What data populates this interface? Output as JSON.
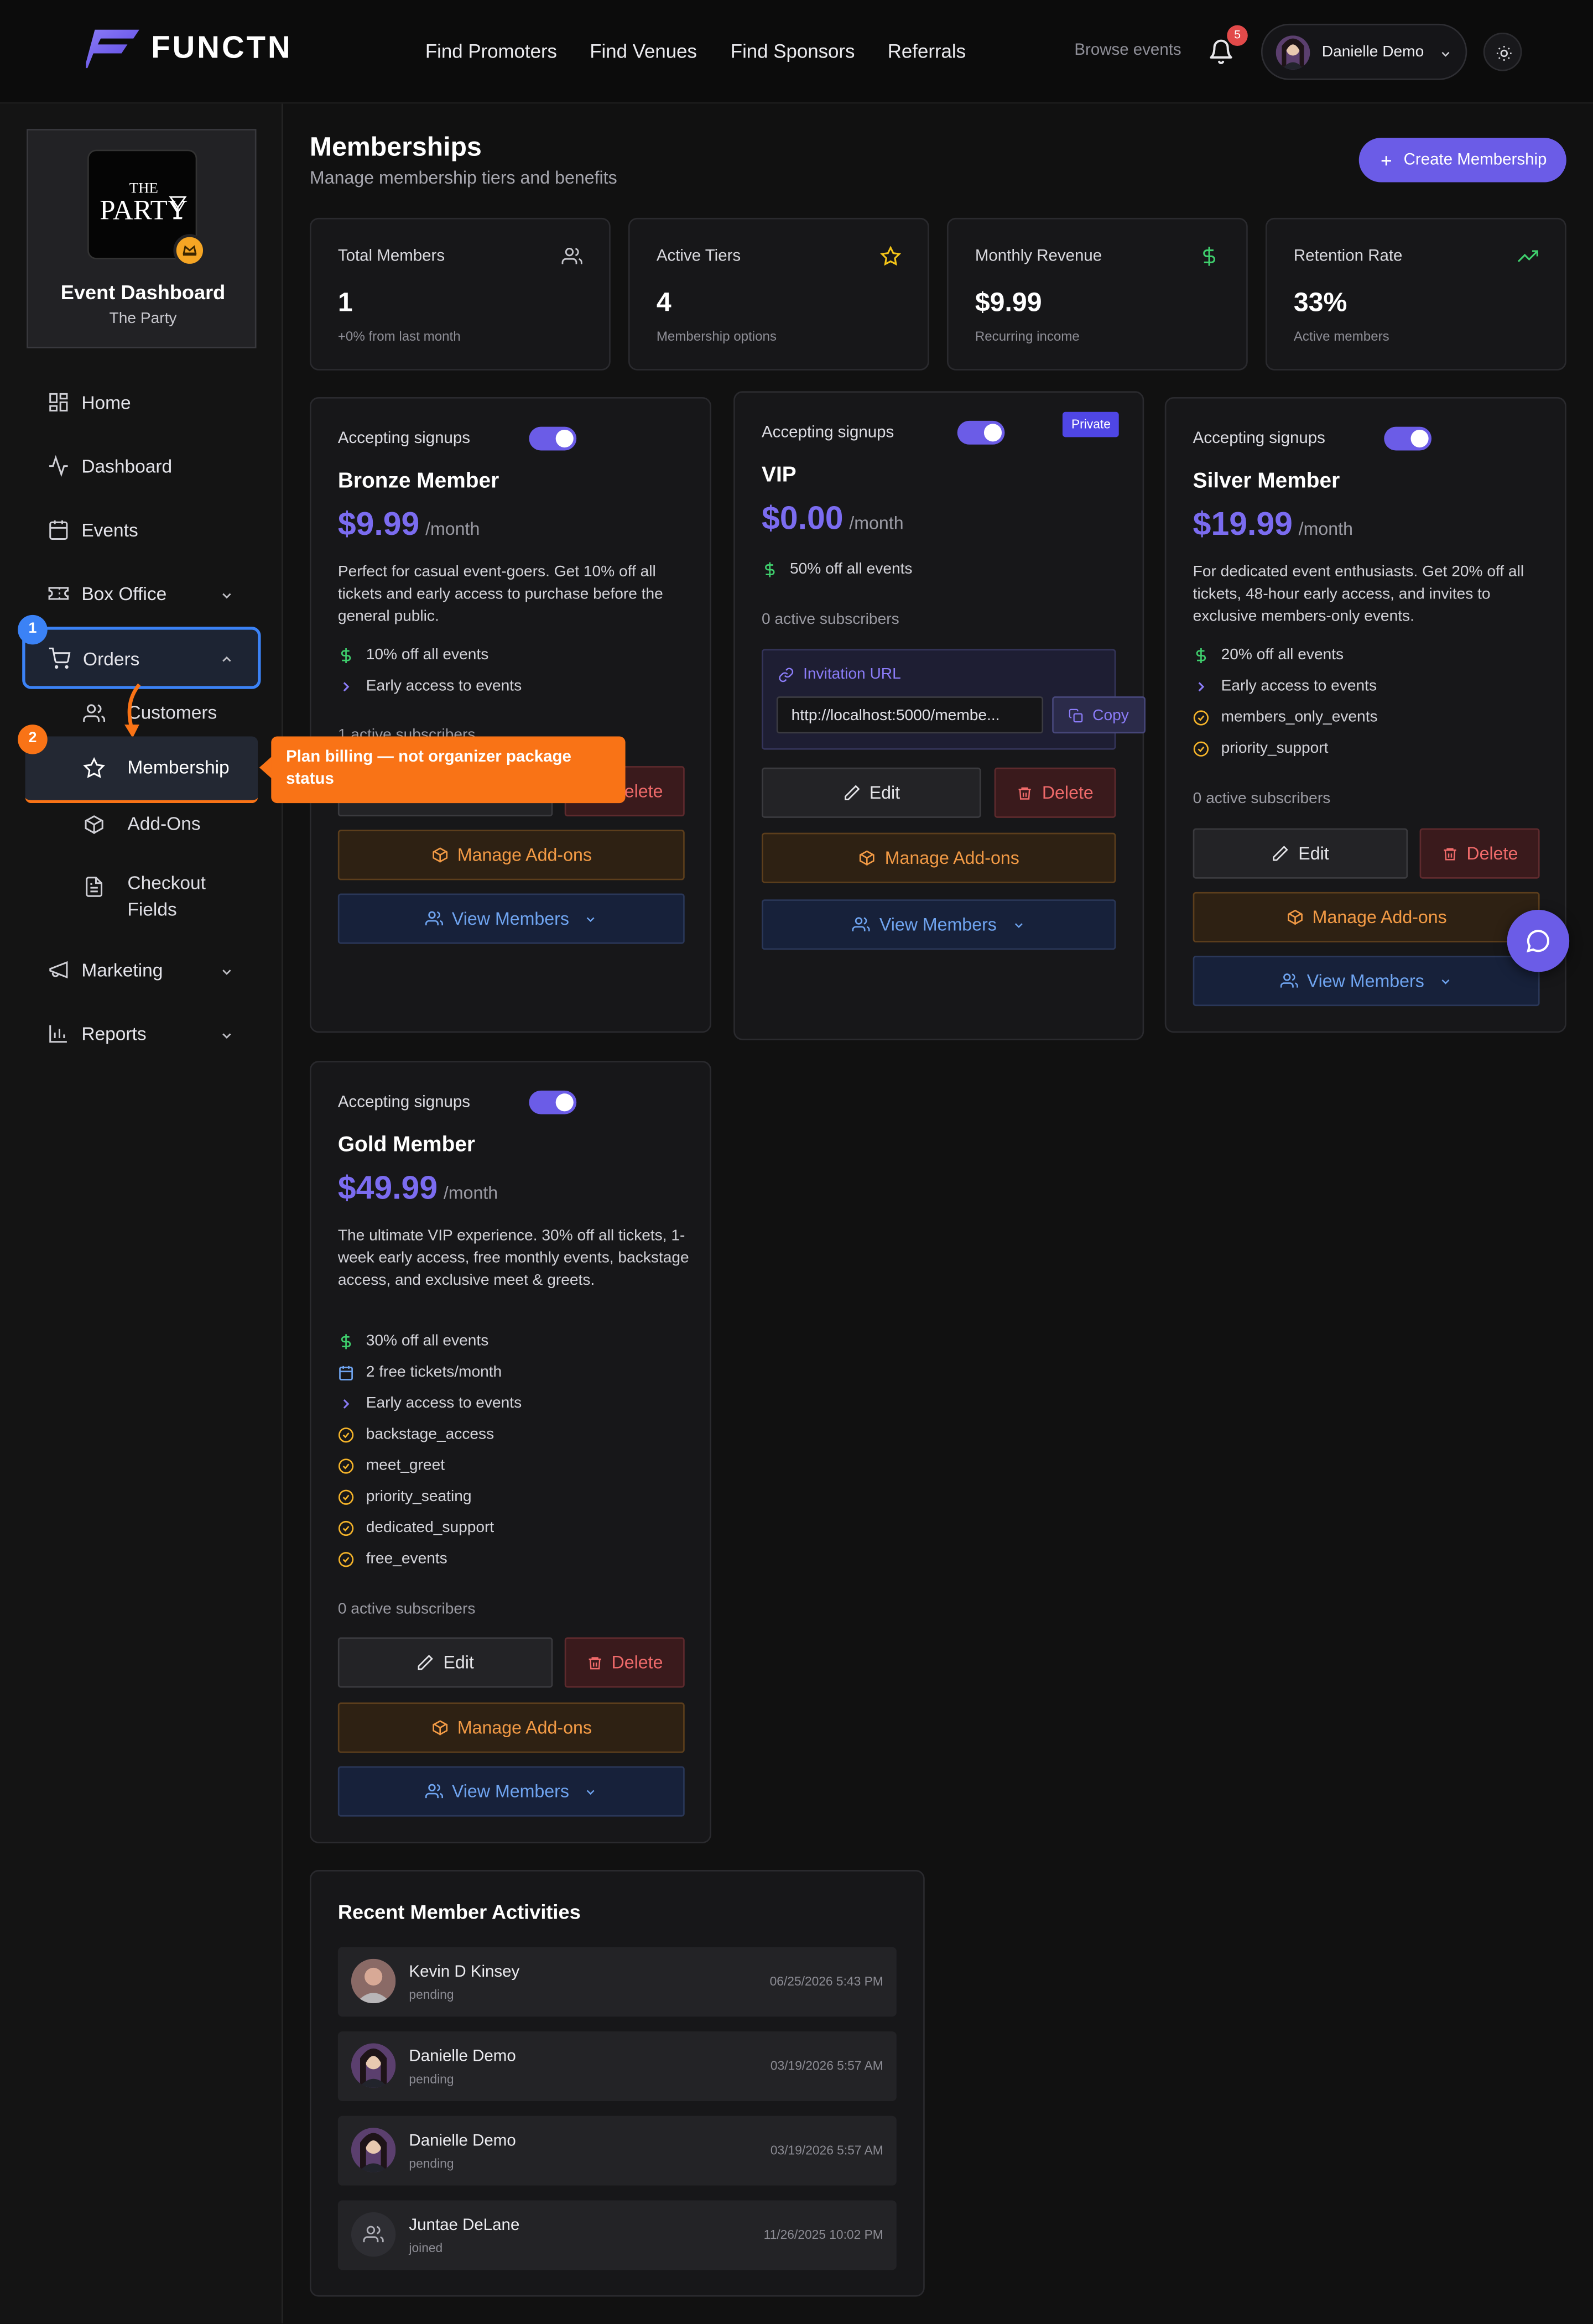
{
  "brand": {
    "name": "FUNCTN"
  },
  "nav": [
    "Find Promoters",
    "Find Venues",
    "Find Sponsors",
    "Referrals"
  ],
  "header": {
    "browse_label": "Browse events",
    "notification_count": "5",
    "user_name": "Danielle Demo"
  },
  "event": {
    "logo_line1": "THE",
    "logo_line2": "PARTY",
    "title": "Event Dashboard",
    "name": "The Party"
  },
  "sidebar": {
    "home": "Home",
    "dashboard": "Dashboard",
    "events": "Events",
    "box_office": "Box Office",
    "orders": "Orders",
    "customers": "Customers",
    "membership": "Membership",
    "addons": "Add-Ons",
    "checkout_fields": "Checkout Fields",
    "marketing": "Marketing",
    "reports": "Reports"
  },
  "guide": {
    "step1": "1",
    "step2": "2",
    "tooltip": "Plan billing — not organizer package status"
  },
  "page": {
    "title": "Memberships",
    "subtitle": "Manage membership tiers and benefits",
    "create_button": "Create Membership"
  },
  "stats": [
    {
      "label": "Total Members",
      "value": "1",
      "sub": "+0% from last month",
      "icon": "users-icon"
    },
    {
      "label": "Active Tiers",
      "value": "4",
      "sub": "Membership options",
      "icon": "star-icon"
    },
    {
      "label": "Monthly Revenue",
      "value": "$9.99",
      "sub": "Recurring income",
      "icon": "dollar-icon"
    },
    {
      "label": "Retention Rate",
      "value": "33%",
      "sub": "Active members",
      "icon": "trending-up-icon"
    }
  ],
  "common": {
    "accepting": "Accepting signups",
    "per_month": "/month",
    "edit": "Edit",
    "delete": "Delete",
    "manage_addons": "Manage Add-ons",
    "view_members": "View Members",
    "private_badge": "Private",
    "invitation_label": "Invitation URL",
    "invitation_url": "http://localhost:5000/membe...",
    "copy": "Copy"
  },
  "tiers": {
    "bronze": {
      "name": "Bronze Member",
      "price": "$9.99",
      "description": "Perfect for casual event-goers. Get 10% off all tickets and early access to purchase before the general public.",
      "features": [
        "10% off all events",
        "Early access to events"
      ],
      "subscribers": "1 active subscribers"
    },
    "vip": {
      "name": "VIP",
      "price": "$0.00",
      "features": [
        "50% off all events"
      ],
      "subscribers": "0 active subscribers"
    },
    "silver": {
      "name": "Silver Member",
      "price": "$19.99",
      "description": "For dedicated event enthusiasts. Get 20% off all tickets, 48-hour early access, and invites to exclusive members-only events.",
      "features": [
        "20% off all events",
        "Early access to events",
        "members_only_events",
        "priority_support"
      ],
      "subscribers": "0 active subscribers"
    },
    "gold": {
      "name": "Gold Member",
      "price": "$49.99",
      "description": "The ultimate VIP experience. 30% off all tickets, 1-week early access, free monthly events, backstage access, and exclusive meet & greets.",
      "features": [
        "30% off all events",
        "2 free tickets/month",
        "Early access to events",
        "backstage_access",
        "meet_greet",
        "priority_seating",
        "dedicated_support",
        "free_events"
      ],
      "subscribers": "0 active subscribers"
    }
  },
  "activities": {
    "title": "Recent Member Activities",
    "items": [
      {
        "name": "Kevin D Kinsey",
        "status": "pending",
        "date": "06/25/2026 5:43 PM"
      },
      {
        "name": "Danielle Demo",
        "status": "pending",
        "date": "03/19/2026 5:57 AM"
      },
      {
        "name": "Danielle Demo",
        "status": "pending",
        "date": "03/19/2026 5:57 AM"
      },
      {
        "name": "Juntae DeLane",
        "status": "joined",
        "date": "11/26/2025 10:02 PM"
      }
    ]
  },
  "colors": {
    "accent": "#6b5ce7",
    "price": "#7b6cf0",
    "guide_blue": "#3b82f6",
    "guide_orange": "#f97316",
    "danger": "#ef6a6a",
    "addon": "#f29a45",
    "view": "#6fa4f0"
  }
}
